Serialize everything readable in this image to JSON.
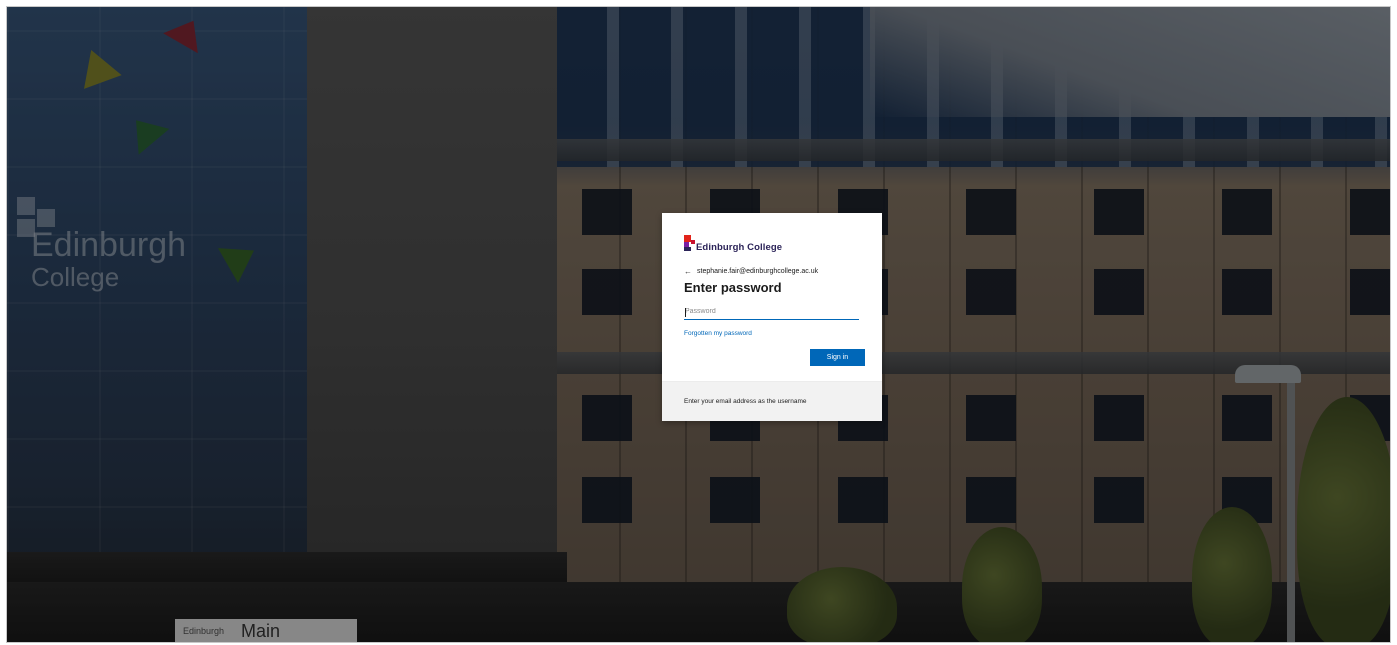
{
  "background": {
    "building_sign": {
      "line1": "Edinburgh",
      "line2": "College"
    },
    "entrance_sign": {
      "logo_text": "Edinburgh",
      "label": "Main Entrance"
    }
  },
  "login": {
    "brand": {
      "name": "Edinburgh College",
      "logo_colors": [
        "#e2231a",
        "#c8102e",
        "#2b2358",
        "#7a1fa2"
      ]
    },
    "identity": {
      "back_icon": "arrow-left-icon",
      "email": "stephanie.fair@edinburghcollege.ac.uk"
    },
    "title": "Enter password",
    "password": {
      "placeholder": "Password",
      "value": ""
    },
    "forgot_link": "Forgotten my password",
    "signin_button": "Sign in",
    "footer_text": "Enter your email address as the username",
    "accent_color": "#0067b8"
  }
}
